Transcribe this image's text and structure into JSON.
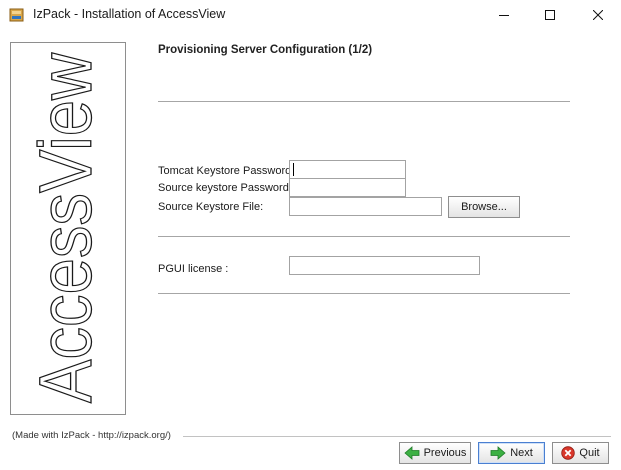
{
  "window": {
    "title": "IzPack - Installation of  AccessView",
    "icon": "izpack-app-icon",
    "controls": [
      "minimize-icon",
      "maximize-icon",
      "close-icon"
    ]
  },
  "side_panel": {
    "logo_text": "AccessView"
  },
  "panel": {
    "title": "Provisioning Server Configuration (1/2)",
    "fields": {
      "tomcat_keystore_password": {
        "label": "Tomcat Keystore Password:",
        "value": ""
      },
      "source_keystore_password": {
        "label": "Source keystore Password:",
        "value": ""
      },
      "source_keystore_file": {
        "label": "Source Keystore File:",
        "value": ""
      },
      "pgui_license": {
        "label": "PGUI license :",
        "value": ""
      }
    },
    "browse_label": "Browse..."
  },
  "footer": {
    "made_with": "(Made with IzPack - http://izpack.org/)",
    "previous_label": "Previous",
    "next_label": "Next",
    "quit_label": "Quit"
  },
  "colors": {
    "previous_arrow": "#3cb043",
    "next_arrow": "#3cb043",
    "quit_icon": "#d9372b",
    "focus_border": "#4a7fd1"
  }
}
